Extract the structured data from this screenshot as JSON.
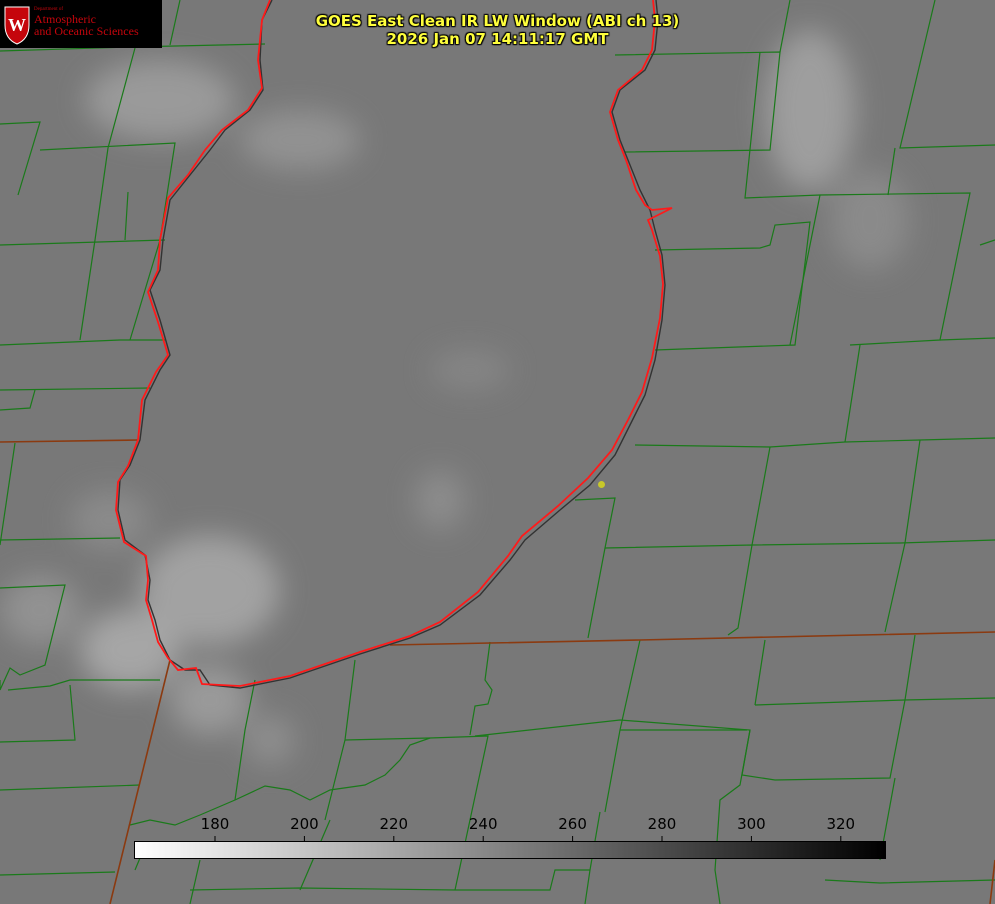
{
  "title": {
    "line1": "GOES East Clean IR LW Window (ABI ch 13)",
    "line2": "2026 Jan 07 14:11:17 GMT"
  },
  "logo": {
    "department": "Department of",
    "line1": "Atmospheric",
    "line2": "and Oceanic Sciences",
    "crest_letter": "W",
    "color": "#c5050c"
  },
  "colorbar": {
    "ticks": [
      "180",
      "200",
      "220",
      "240",
      "260",
      "280",
      "300",
      "320"
    ],
    "min_color": "#ffffff",
    "max_color": "#000000"
  },
  "map": {
    "background": "#7a7a7a",
    "county_border_color": "#1a7a1a",
    "coastline_color": "#e01010",
    "state_border_color": "#8b3a10"
  }
}
